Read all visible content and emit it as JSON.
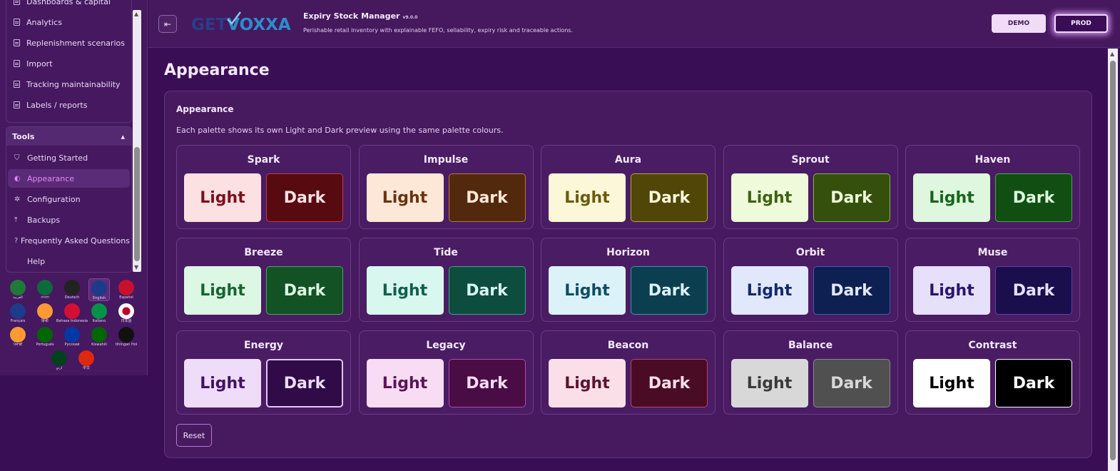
{
  "sidebar": {
    "top_items": [
      {
        "label": "Dashboards & capital",
        "icon": "list-icon"
      },
      {
        "label": "Analytics",
        "icon": "list-icon"
      },
      {
        "label": "Replenishment scenarios",
        "icon": "list-icon"
      },
      {
        "label": "Import",
        "icon": "list-icon"
      },
      {
        "label": "Tracking maintainability",
        "icon": "list-icon"
      },
      {
        "label": "Labels / reports",
        "icon": "list-icon"
      }
    ],
    "tools_title": "Tools",
    "tools_toggle": "▴",
    "tools_items": [
      {
        "label": "Getting Started",
        "glyph": "⛉",
        "icon": "start-icon"
      },
      {
        "label": "Appearance",
        "glyph": "◐",
        "icon": "palette-icon",
        "active": true
      },
      {
        "label": "Configuration",
        "glyph": "✲",
        "icon": "gear-icon"
      },
      {
        "label": "Backups",
        "glyph": "⤒",
        "icon": "upload-icon"
      },
      {
        "label": "Frequently Asked Questions",
        "glyph": "?",
        "icon": "question-icon"
      },
      {
        "label": "Help",
        "glyph": "",
        "icon": "help-icon"
      }
    ],
    "languages": [
      {
        "label": "العربية",
        "color": "#1f7a3a"
      },
      {
        "label": "বাংলা",
        "color": "#0b6b3a"
      },
      {
        "label": "Deutsch",
        "color": "#222222"
      },
      {
        "label": "English",
        "color": "#1e3a8a",
        "selected": true
      },
      {
        "label": "Español",
        "color": "#c8102e"
      },
      {
        "label": "Français",
        "color": "#1e3a8a"
      },
      {
        "label": "हिन्दी",
        "color": "#ff9933"
      },
      {
        "label": "Bahasa Indonesia",
        "color": "#d21034"
      },
      {
        "label": "Italiano",
        "color": "#009246"
      },
      {
        "label": "日本語",
        "color": "#ffffff"
      },
      {
        "label": "ਪੰਜਾਬੀ",
        "color": "#ff9933"
      },
      {
        "label": "Português",
        "color": "#006600"
      },
      {
        "label": "Русский",
        "color": "#0039a6"
      },
      {
        "label": "Kiswahili",
        "color": "#006600"
      },
      {
        "label": "tlhIngan Hol",
        "color": "#111111"
      },
      {
        "label": "اردو",
        "color": "#01411c"
      },
      {
        "label": "中文",
        "color": "#de2910"
      }
    ]
  },
  "header": {
    "logo_part1": "GET",
    "logo_part2": "VOXXA",
    "app_title": "Expiry Stock Manager",
    "version": "v9.0.0",
    "subtitle": "Perishable retail inventory with explainable FEFO, sellability, expiry risk and traceable actions.",
    "demo_label": "DEMO",
    "prod_label": "PROD",
    "collapse_glyph": "⇤"
  },
  "main": {
    "page_title": "Appearance",
    "panel_title": "Appearance",
    "panel_desc": "Each palette shows its own Light and Dark preview using the same palette colours.",
    "light_label": "Light",
    "dark_label": "Dark",
    "reset_label": "Reset",
    "palettes": [
      {
        "name": "Spark",
        "light_bg": "#fde0e2",
        "light_fg": "#7a1020",
        "light_border": "#fde0e2",
        "dark_bg": "#570a10",
        "dark_fg": "#fbe1e5",
        "dark_border": "#c33a48"
      },
      {
        "name": "Impulse",
        "light_bg": "#fde8d8",
        "light_fg": "#6a3410",
        "light_border": "#fde8d8",
        "dark_bg": "#52290d",
        "dark_fg": "#fde8d8",
        "dark_border": "#b9763e"
      },
      {
        "name": "Aura",
        "light_bg": "#fdf7d9",
        "light_fg": "#6a5c0a",
        "light_border": "#fdf7d9",
        "dark_bg": "#4f4607",
        "dark_fg": "#fdf7d9",
        "dark_border": "#b5a73e"
      },
      {
        "name": "Sprout",
        "light_bg": "#eefad9",
        "light_fg": "#3f6212",
        "light_border": "#eefad9",
        "dark_bg": "#35500c",
        "dark_fg": "#eefad9",
        "dark_border": "#86b548"
      },
      {
        "name": "Haven",
        "light_bg": "#dff7de",
        "light_fg": "#17651b",
        "light_border": "#dff7de",
        "dark_bg": "#114e12",
        "dark_fg": "#dff7de",
        "dark_border": "#4ca852"
      },
      {
        "name": "Breeze",
        "light_bg": "#dcf7e4",
        "light_fg": "#16652f",
        "light_border": "#dcf7e4",
        "dark_bg": "#125224",
        "dark_fg": "#dcf7e4",
        "dark_border": "#49a862"
      },
      {
        "name": "Tide",
        "light_bg": "#d8f7ef",
        "light_fg": "#115e4c",
        "light_border": "#d8f7ef",
        "dark_bg": "#0d4d3e",
        "dark_fg": "#d8f7ef",
        "dark_border": "#3fa38a"
      },
      {
        "name": "Horizon",
        "light_bg": "#dcf2f9",
        "light_fg": "#0f4d63",
        "light_border": "#dcf2f9",
        "dark_bg": "#0b3f4f",
        "dark_fg": "#dcf2f9",
        "dark_border": "#3b95b0"
      },
      {
        "name": "Orbit",
        "light_bg": "#e1e8fb",
        "light_fg": "#14296b",
        "light_border": "#e1e8fb",
        "dark_bg": "#0e1f52",
        "dark_fg": "#e1e8fb",
        "dark_border": "#3f5fb3"
      },
      {
        "name": "Muse",
        "light_bg": "#e6e0fb",
        "light_fg": "#2a1668",
        "light_border": "#e6e0fb",
        "dark_bg": "#1b0e4c",
        "dark_fg": "#e6e0fb",
        "dark_border": "#5a44b0"
      },
      {
        "name": "Energy",
        "light_bg": "#efdcf9",
        "light_fg": "#3f1460",
        "light_border": "#efdcf9",
        "dark_bg": "#300b48",
        "dark_fg": "#efdcf9",
        "dark_border": "#e2c6f5"
      },
      {
        "name": "Legacy",
        "light_bg": "#f8dcf4",
        "light_fg": "#5c1457",
        "light_border": "#f8dcf4",
        "dark_bg": "#490c45",
        "dark_fg": "#f8dcf4",
        "dark_border": "#b34aa9"
      },
      {
        "name": "Beacon",
        "light_bg": "#fbdfe8",
        "light_fg": "#5c1230",
        "light_border": "#fbdfe8",
        "dark_bg": "#4a0c24",
        "dark_fg": "#fbdfe8",
        "dark_border": "#b3476c"
      },
      {
        "name": "Balance",
        "light_bg": "#d8d8d8",
        "light_fg": "#3a3a3a",
        "light_border": "#d8d8d8",
        "dark_bg": "#505050",
        "dark_fg": "#d8d8d8",
        "dark_border": "#8a8a8a"
      },
      {
        "name": "Contrast",
        "light_bg": "#ffffff",
        "light_fg": "#000000",
        "light_border": "#ffffff",
        "dark_bg": "#000000",
        "dark_fg": "#ffffff",
        "dark_border": "#ffffff"
      }
    ]
  }
}
